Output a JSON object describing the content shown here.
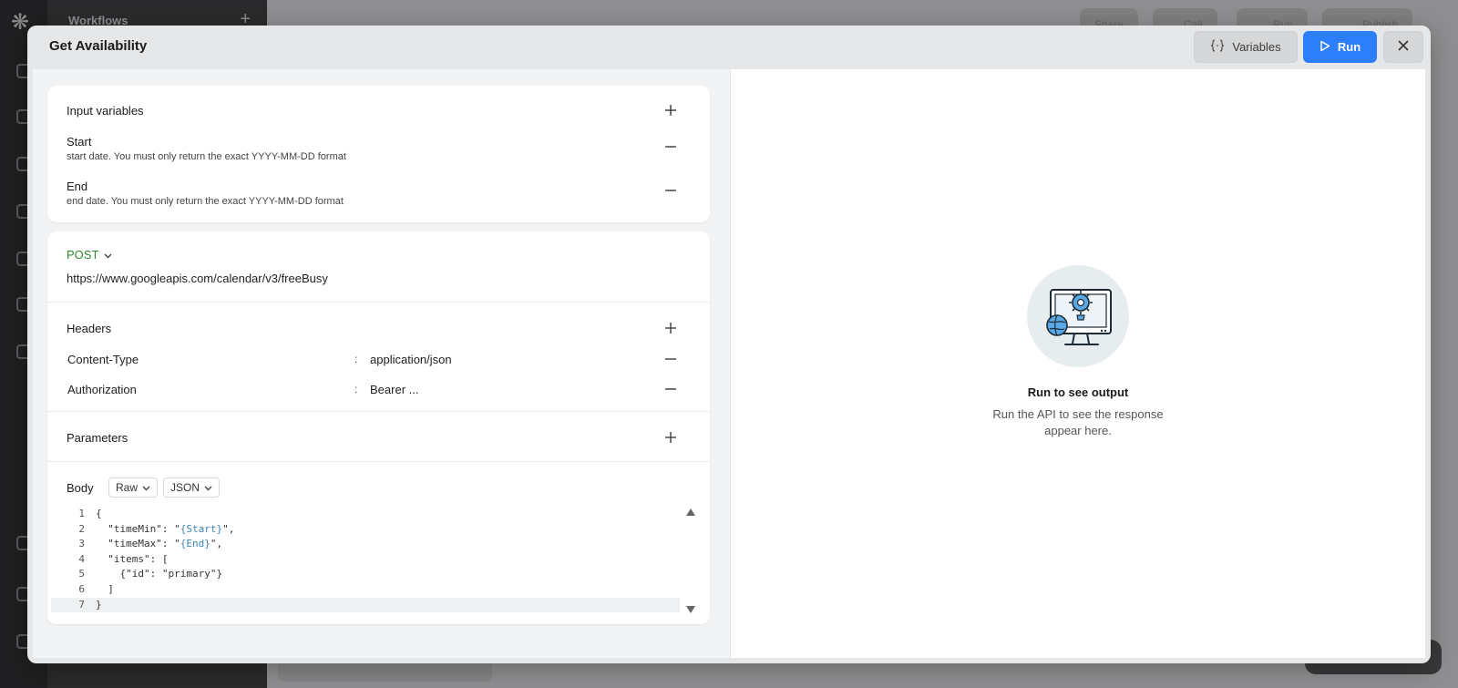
{
  "background": {
    "sidebar_title": "Workflows",
    "top_buttons": [
      "Share",
      "Call",
      "Run",
      "Publish"
    ]
  },
  "modal": {
    "title": "Get Availability",
    "variables_label": "Variables",
    "run_label": "Run"
  },
  "input_variables": {
    "title": "Input variables",
    "items": [
      {
        "name": "Start",
        "description": "start date. You must only return the exact YYYY-MM-DD format"
      },
      {
        "name": "End",
        "description": "end date. You must only return the exact YYYY-MM-DD format"
      }
    ]
  },
  "request": {
    "method": "POST",
    "url": "https://www.googleapis.com/calendar/v3/freeBusy",
    "headers_title": "Headers",
    "headers": [
      {
        "key": "Content-Type",
        "value": "application/json"
      },
      {
        "key": "Authorization",
        "value": "Bearer ..."
      }
    ],
    "parameters_title": "Parameters",
    "body_label": "Body",
    "body_mode": "Raw",
    "body_format": "JSON",
    "body_lines": [
      {
        "n": "1",
        "text": "{"
      },
      {
        "n": "2",
        "text": "  \"timeMin\": \"{Start}\","
      },
      {
        "n": "3",
        "text": "  \"timeMax\": \"{End}\","
      },
      {
        "n": "4",
        "text": "  \"items\": ["
      },
      {
        "n": "5",
        "text": "    {\"id\": \"primary\"}"
      },
      {
        "n": "6",
        "text": "  ]"
      },
      {
        "n": "7",
        "text": "}"
      }
    ]
  },
  "output": {
    "empty_title": "Run to see output",
    "empty_desc": "Run the API to see the response appear here."
  },
  "colors": {
    "accent": "#2d7ff9",
    "method_post": "#2f8a2f",
    "variable_token": "#3d86b8"
  }
}
